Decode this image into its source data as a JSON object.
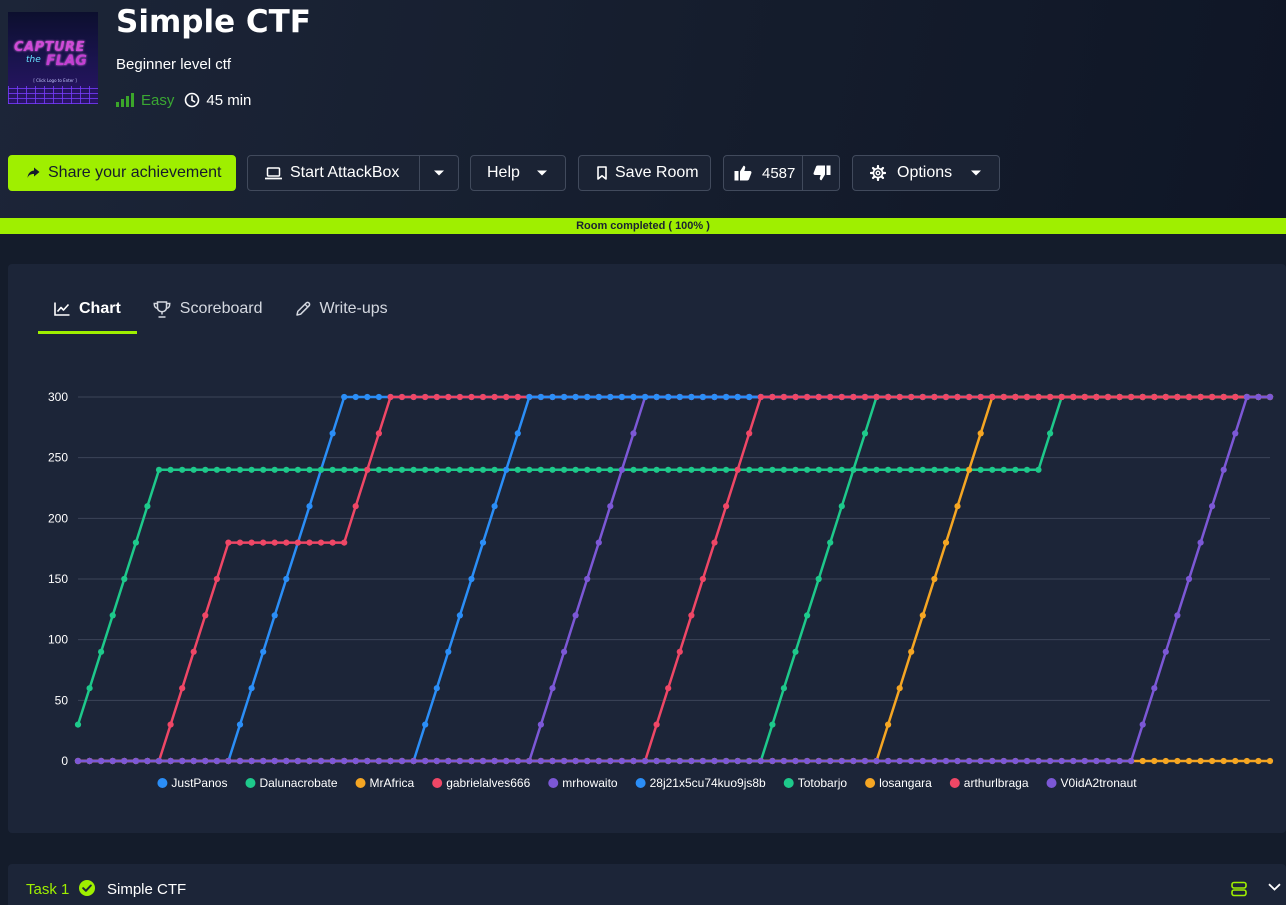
{
  "room": {
    "title": "Simple CTF",
    "description": "Beginner level ctf",
    "difficulty": "Easy",
    "duration": "45 min",
    "logo": {
      "line1": "CAPTURE",
      "line2": "the",
      "line3": "FLAG",
      "caption": "[ Click Logo to Enter ]"
    }
  },
  "toolbar": {
    "share_label": "Share your achievement",
    "attackbox_label": "Start AttackBox",
    "help_label": "Help",
    "save_label": "Save Room",
    "likes": "4587",
    "options_label": "Options"
  },
  "progress": {
    "label": "Room completed ( 100% )",
    "percent": 100
  },
  "tabs": [
    {
      "label": "Chart",
      "icon": "chart-line-icon",
      "active": true
    },
    {
      "label": "Scoreboard",
      "icon": "trophy-icon",
      "active": false
    },
    {
      "label": "Write-ups",
      "icon": "pencil-icon",
      "active": false
    }
  ],
  "colors": {
    "accent": "#9fef00",
    "difficulty": "#3aa733",
    "background": "#141c2b",
    "panel": "#1c2538"
  },
  "chart_data": {
    "type": "line",
    "title": "",
    "xlabel": "",
    "ylabel": "",
    "ylim": [
      0,
      300
    ],
    "yticks": [
      0,
      50,
      100,
      150,
      200,
      250,
      300
    ],
    "point_count": 104,
    "grid": true,
    "legend_position": "bottom",
    "series": [
      {
        "name": "JustPanos",
        "color": "#2b8ef7",
        "values": [
          0,
          0,
          0,
          0,
          0,
          0,
          0,
          0,
          0,
          0,
          0,
          0,
          0,
          0,
          30,
          60,
          90,
          120,
          150,
          180,
          210,
          240,
          270,
          300,
          300,
          300,
          300,
          300,
          300,
          300,
          300,
          300,
          300,
          300,
          300,
          300,
          300,
          300,
          300,
          300,
          300,
          300,
          300,
          300,
          300,
          300,
          300,
          300,
          300,
          300,
          300,
          300,
          300,
          300,
          300,
          300,
          300,
          300,
          300,
          300,
          300,
          300,
          300,
          300,
          300,
          300,
          300,
          300,
          300,
          300,
          300,
          300,
          300,
          300,
          300,
          300,
          300,
          300,
          300,
          300,
          300,
          300,
          300,
          300,
          300,
          300,
          300,
          300,
          300,
          300,
          300,
          300,
          300,
          300,
          300,
          300,
          300,
          300,
          300,
          300,
          300,
          300,
          300,
          300
        ]
      },
      {
        "name": "Dalunacrobate",
        "color": "#1ec98b",
        "values": [
          30,
          60,
          90,
          120,
          150,
          180,
          210,
          240,
          240,
          240,
          240,
          240,
          240,
          240,
          240,
          240,
          240,
          240,
          240,
          240,
          240,
          240,
          240,
          240,
          240,
          240,
          240,
          240,
          240,
          240,
          240,
          240,
          240,
          240,
          240,
          240,
          240,
          240,
          240,
          240,
          240,
          240,
          240,
          240,
          240,
          240,
          240,
          240,
          240,
          240,
          240,
          240,
          240,
          240,
          240,
          240,
          240,
          240,
          240,
          240,
          240,
          240,
          240,
          240,
          240,
          240,
          240,
          240,
          240,
          240,
          240,
          240,
          240,
          240,
          240,
          240,
          240,
          240,
          240,
          240,
          240,
          240,
          240,
          240,
          270,
          300,
          300,
          300,
          300,
          300,
          300,
          300,
          300,
          300,
          300,
          300,
          300,
          300,
          300,
          300,
          300,
          300,
          300,
          300
        ]
      },
      {
        "name": "MrAfrica",
        "color": "#f5a623",
        "values": [
          0,
          0,
          0,
          0,
          0,
          0,
          0,
          0,
          0,
          0,
          0,
          0,
          0,
          0,
          0,
          0,
          0,
          0,
          0,
          0,
          0,
          0,
          0,
          0,
          0,
          0,
          0,
          0,
          0,
          0,
          0,
          0,
          0,
          0,
          0,
          0,
          0,
          0,
          0,
          0,
          0,
          0,
          0,
          0,
          0,
          0,
          0,
          0,
          0,
          0,
          0,
          0,
          0,
          0,
          0,
          0,
          0,
          0,
          0,
          0,
          0,
          0,
          0,
          0,
          0,
          0,
          0,
          0,
          0,
          0,
          0,
          0,
          0,
          0,
          0,
          0,
          0,
          0,
          0,
          0,
          0,
          0,
          0,
          0,
          0,
          0,
          0,
          0,
          0,
          0,
          0,
          0,
          0,
          0,
          0,
          0,
          0,
          0,
          0,
          0,
          0,
          0,
          0,
          0
        ]
      },
      {
        "name": "gabrielalves666",
        "color": "#ef4766",
        "values": [
          0,
          0,
          0,
          0,
          0,
          0,
          0,
          0,
          30,
          60,
          90,
          120,
          150,
          180,
          180,
          180,
          180,
          180,
          180,
          180,
          180,
          180,
          180,
          180,
          210,
          240,
          270,
          300,
          300,
          300,
          300,
          300,
          300,
          300,
          300,
          300,
          300,
          300,
          300,
          300,
          300,
          300,
          300,
          300,
          300,
          300,
          300,
          300,
          300,
          300,
          300,
          300,
          300,
          300,
          300,
          300,
          300,
          300,
          300,
          300,
          300,
          300,
          300,
          300,
          300,
          300,
          300,
          300,
          300,
          300,
          300,
          300,
          300,
          300,
          300,
          300,
          300,
          300,
          300,
          300,
          300,
          300,
          300,
          300,
          300,
          300,
          300,
          300,
          300,
          300,
          300,
          300,
          300,
          300,
          300,
          300,
          300,
          300,
          300,
          300,
          300,
          300,
          300,
          300
        ]
      },
      {
        "name": "mrhowaito",
        "color": "#7c58d6",
        "values": [
          0,
          0,
          0,
          0,
          0,
          0,
          0,
          0,
          0,
          0,
          0,
          0,
          0,
          0,
          0,
          0,
          0,
          0,
          0,
          0,
          0,
          0,
          0,
          0,
          0,
          0,
          0,
          0,
          0,
          0,
          0,
          0,
          0,
          0,
          0,
          0,
          0,
          0,
          0,
          0,
          30,
          60,
          90,
          120,
          150,
          180,
          210,
          240,
          270,
          300,
          300,
          300,
          300,
          300,
          300,
          300,
          300,
          300,
          300,
          300,
          300,
          300,
          300,
          300,
          300,
          300,
          300,
          300,
          300,
          300,
          300,
          300,
          300,
          300,
          300,
          300,
          300,
          300,
          300,
          300,
          300,
          300,
          300,
          300,
          300,
          300,
          300,
          300,
          300,
          300,
          300,
          300,
          300,
          300,
          300,
          300,
          300,
          300,
          300,
          300,
          300,
          300,
          300,
          300
        ]
      },
      {
        "name": "28j21x5cu74kuo9js8b",
        "color": "#2b8ef7",
        "values": [
          0,
          0,
          0,
          0,
          0,
          0,
          0,
          0,
          0,
          0,
          0,
          0,
          0,
          0,
          0,
          0,
          0,
          0,
          0,
          0,
          0,
          0,
          0,
          0,
          0,
          0,
          0,
          0,
          0,
          0,
          30,
          60,
          90,
          120,
          150,
          180,
          210,
          240,
          270,
          300,
          300,
          300,
          300,
          300,
          300,
          300,
          300,
          300,
          300,
          300,
          300,
          300,
          300,
          300,
          300,
          300,
          300,
          300,
          300,
          300,
          300,
          300,
          300,
          300,
          300,
          300,
          300,
          300,
          300,
          300,
          300,
          300,
          300,
          300,
          300,
          300,
          300,
          300,
          300,
          300,
          300,
          300,
          300,
          300,
          300,
          300,
          300,
          300,
          300,
          300,
          300,
          300,
          300,
          300,
          300,
          300,
          300,
          300,
          300,
          300,
          300,
          300,
          300,
          300
        ]
      },
      {
        "name": "Totobarjo",
        "color": "#1ec98b",
        "values": [
          0,
          0,
          0,
          0,
          0,
          0,
          0,
          0,
          0,
          0,
          0,
          0,
          0,
          0,
          0,
          0,
          0,
          0,
          0,
          0,
          0,
          0,
          0,
          0,
          0,
          0,
          0,
          0,
          0,
          0,
          0,
          0,
          0,
          0,
          0,
          0,
          0,
          0,
          0,
          0,
          0,
          0,
          0,
          0,
          0,
          0,
          0,
          0,
          0,
          0,
          0,
          0,
          0,
          0,
          0,
          0,
          0,
          0,
          0,
          0,
          30,
          60,
          90,
          120,
          150,
          180,
          210,
          240,
          270,
          300,
          300,
          300,
          300,
          300,
          300,
          300,
          300,
          300,
          300,
          300,
          300,
          300,
          300,
          300,
          300,
          300,
          300,
          300,
          300,
          300,
          300,
          300,
          300,
          300,
          300,
          300,
          300,
          300,
          300,
          300,
          300,
          300,
          300,
          300
        ]
      },
      {
        "name": "losangara",
        "color": "#f5a623",
        "values": [
          0,
          0,
          0,
          0,
          0,
          0,
          0,
          0,
          0,
          0,
          0,
          0,
          0,
          0,
          0,
          0,
          0,
          0,
          0,
          0,
          0,
          0,
          0,
          0,
          0,
          0,
          0,
          0,
          0,
          0,
          0,
          0,
          0,
          0,
          0,
          0,
          0,
          0,
          0,
          0,
          0,
          0,
          0,
          0,
          0,
          0,
          0,
          0,
          0,
          0,
          0,
          0,
          0,
          0,
          0,
          0,
          0,
          0,
          0,
          0,
          0,
          0,
          0,
          0,
          0,
          0,
          0,
          0,
          0,
          0,
          30,
          60,
          90,
          120,
          150,
          180,
          210,
          240,
          270,
          300,
          300,
          300,
          300,
          300,
          300,
          300,
          300,
          300,
          300,
          300,
          300,
          300,
          300,
          300,
          300,
          300,
          300,
          300,
          300,
          300,
          300,
          300,
          300,
          300
        ]
      },
      {
        "name": "arthurlbraga",
        "color": "#ef4766",
        "values": [
          0,
          0,
          0,
          0,
          0,
          0,
          0,
          0,
          0,
          0,
          0,
          0,
          0,
          0,
          0,
          0,
          0,
          0,
          0,
          0,
          0,
          0,
          0,
          0,
          0,
          0,
          0,
          0,
          0,
          0,
          0,
          0,
          0,
          0,
          0,
          0,
          0,
          0,
          0,
          0,
          0,
          0,
          0,
          0,
          0,
          0,
          0,
          0,
          0,
          0,
          30,
          60,
          90,
          120,
          150,
          180,
          210,
          240,
          270,
          300,
          300,
          300,
          300,
          300,
          300,
          300,
          300,
          300,
          300,
          300,
          300,
          300,
          300,
          300,
          300,
          300,
          300,
          300,
          300,
          300,
          300,
          300,
          300,
          300,
          300,
          300,
          300,
          300,
          300,
          300,
          300,
          300,
          300,
          300,
          300,
          300,
          300,
          300,
          300,
          300,
          300,
          300,
          300,
          300
        ]
      },
      {
        "name": "V0idA2tronaut",
        "color": "#7c58d6",
        "values": [
          0,
          0,
          0,
          0,
          0,
          0,
          0,
          0,
          0,
          0,
          0,
          0,
          0,
          0,
          0,
          0,
          0,
          0,
          0,
          0,
          0,
          0,
          0,
          0,
          0,
          0,
          0,
          0,
          0,
          0,
          0,
          0,
          0,
          0,
          0,
          0,
          0,
          0,
          0,
          0,
          0,
          0,
          0,
          0,
          0,
          0,
          0,
          0,
          0,
          0,
          0,
          0,
          0,
          0,
          0,
          0,
          0,
          0,
          0,
          0,
          0,
          0,
          0,
          0,
          0,
          0,
          0,
          0,
          0,
          0,
          0,
          0,
          0,
          0,
          0,
          0,
          0,
          0,
          0,
          0,
          0,
          0,
          0,
          0,
          0,
          0,
          0,
          0,
          0,
          0,
          0,
          0,
          30,
          60,
          90,
          120,
          150,
          180,
          210,
          240,
          270,
          300,
          300,
          300
        ]
      }
    ]
  },
  "task": {
    "number_label": "Task 1",
    "title": "Simple CTF"
  }
}
